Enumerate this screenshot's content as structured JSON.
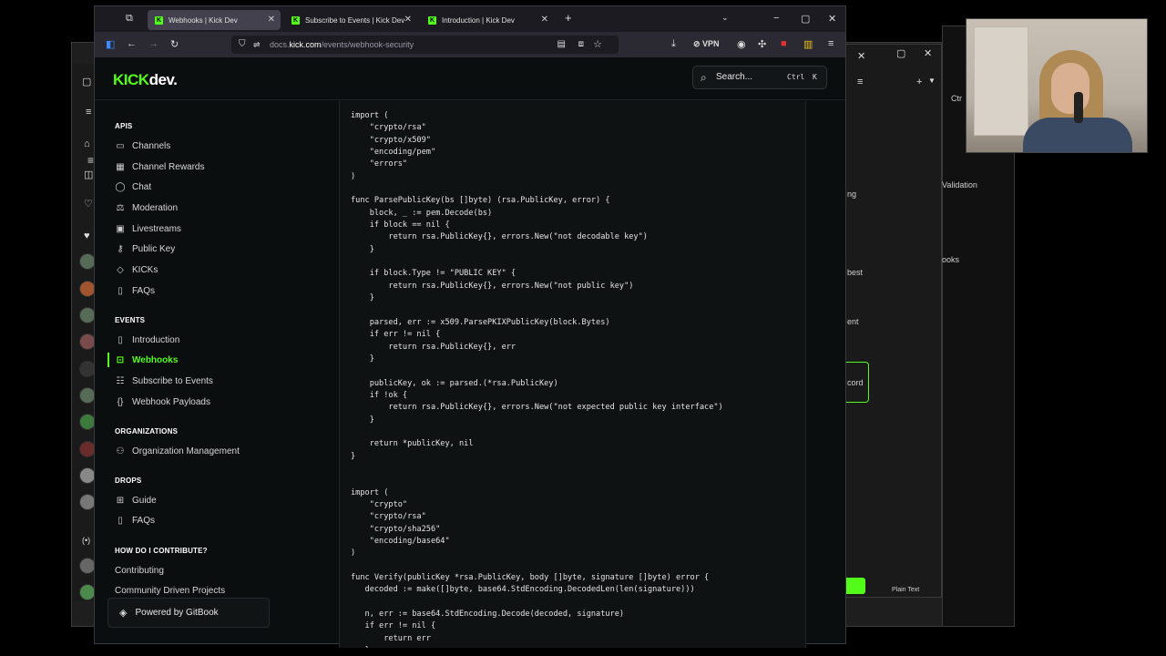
{
  "browser": {
    "tabs": [
      {
        "title": "Webhooks | Kick Dev",
        "active": true
      },
      {
        "title": "Subscribe to Events | Kick Dev",
        "active": false
      },
      {
        "title": "Introduction | Kick Dev",
        "active": false
      }
    ],
    "url_prefix": "docs.",
    "url_host": "kick.com",
    "url_path": "/events/webhook-security",
    "vpn_label": "VPN"
  },
  "header": {
    "logo_main": "KICK",
    "logo_dev": "dev.",
    "search_placeholder": "Search...",
    "shortcut_key1": "Ctrl",
    "shortcut_key2": "K"
  },
  "sidebar": {
    "sections": [
      {
        "title": "APIS",
        "items": [
          {
            "label": "Channels",
            "icon": "tv-icon"
          },
          {
            "label": "Channel Rewards",
            "icon": "grid-icon"
          },
          {
            "label": "Chat",
            "icon": "chat-icon"
          },
          {
            "label": "Moderation",
            "icon": "moderation-icon"
          },
          {
            "label": "Livestreams",
            "icon": "livestream-icon"
          },
          {
            "label": "Public Key",
            "icon": "key-icon"
          },
          {
            "label": "KICKs",
            "icon": "gem-icon"
          },
          {
            "label": "FAQs",
            "icon": "faq-icon"
          }
        ]
      },
      {
        "title": "EVENTS",
        "items": [
          {
            "label": "Introduction",
            "icon": "book-icon"
          },
          {
            "label": "Webhooks",
            "icon": "lock-icon",
            "active": true
          },
          {
            "label": "Subscribe to Events",
            "icon": "list-icon"
          },
          {
            "label": "Webhook Payloads",
            "icon": "braces-icon"
          }
        ]
      },
      {
        "title": "ORGANIZATIONS",
        "items": [
          {
            "label": "Organization Management",
            "icon": "users-icon"
          }
        ]
      },
      {
        "title": "DROPS",
        "items": [
          {
            "label": "Guide",
            "icon": "gift-icon"
          },
          {
            "label": "FAQs",
            "icon": "faq-icon"
          }
        ]
      },
      {
        "title": "HOW DO I CONTRIBUTE?",
        "items": [
          {
            "label": "Contributing",
            "icon": ""
          },
          {
            "label": "Community Driven Projects",
            "icon": ""
          }
        ]
      }
    ],
    "gitbook_label": "Powered by GitBook"
  },
  "code_lines": [
    "import (",
    "    \"crypto/rsa\"",
    "    \"crypto/x509\"",
    "    \"encoding/pem\"",
    "    \"errors\"",
    ")",
    "",
    "func ParsePublicKey(bs []byte) (rsa.PublicKey, error) {",
    "    block, _ := pem.Decode(bs)",
    "    if block == nil {",
    "        return rsa.PublicKey{}, errors.New(\"not decodable key\")",
    "    }",
    "",
    "    if block.Type != \"PUBLIC KEY\" {",
    "        return rsa.PublicKey{}, errors.New(\"not public key\")",
    "    }",
    "",
    "    parsed, err := x509.ParsePKIXPublicKey(block.Bytes)",
    "    if err != nil {",
    "        return rsa.PublicKey{}, err",
    "    }",
    "",
    "    publicKey, ok := parsed.(*rsa.PublicKey)",
    "    if !ok {",
    "        return rsa.PublicKey{}, errors.New(\"not expected public key interface\")",
    "    }",
    "",
    "    return *publicKey, nil",
    "}",
    "",
    "",
    "import (",
    "    \"crypto\"",
    "    \"crypto/rsa\"",
    "    \"crypto/sha256\"",
    "    \"encoding/base64\"",
    ")",
    "",
    "func Verify(publicKey *rsa.PublicKey, body []byte, signature []byte) error {",
    "   decoded := make([]byte, base64.StdEncoding.DecodedLen(len(signature)))",
    "",
    "   n, err := base64.StdEncoding.Decode(decoded, signature)",
    "   if err != nil {",
    "       return err",
    "   }"
  ],
  "background": {
    "texts": {
      "validation": "Validation",
      "books": "ooks",
      "ng": "ng",
      "best": "best",
      "ent": "ent",
      "cord": "cord",
      "plain_text": "Plain Text",
      "ctr": "Ctr"
    }
  }
}
